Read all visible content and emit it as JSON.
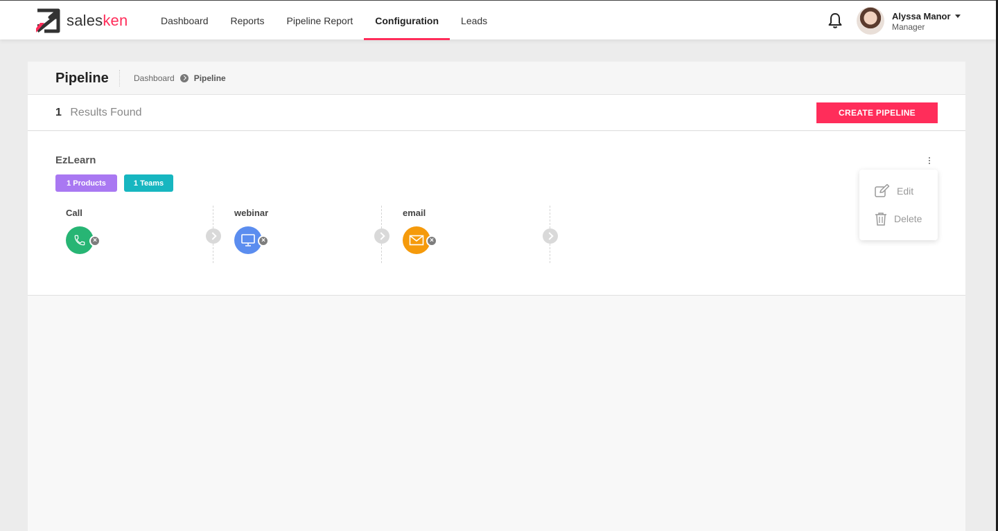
{
  "brand": {
    "name_part1": "sales",
    "name_part2": "ken",
    "accent": "#ff2d5a"
  },
  "nav": {
    "items": [
      {
        "label": "Dashboard"
      },
      {
        "label": "Reports"
      },
      {
        "label": "Pipeline Report"
      },
      {
        "label": "Configuration",
        "active": true
      },
      {
        "label": "Leads"
      }
    ]
  },
  "user": {
    "name": "Alyssa Manor",
    "role": "Manager"
  },
  "page": {
    "title": "Pipeline",
    "breadcrumb": [
      "Dashboard",
      "Pipeline"
    ]
  },
  "results": {
    "count": "1",
    "label": "Results Found",
    "create_button": "CREATE PIPELINE"
  },
  "pipeline": {
    "name": "EzLearn",
    "products_badge": "1 Products",
    "teams_badge": "1 Teams",
    "stages": [
      {
        "label": "Call",
        "icon": "phone-icon",
        "color": "#27b574"
      },
      {
        "label": "webinar",
        "icon": "monitor-icon",
        "color": "#5b8def"
      },
      {
        "label": "email",
        "icon": "envelope-icon",
        "color": "#f59a0b"
      }
    ]
  },
  "menu": {
    "edit": "Edit",
    "delete": "Delete"
  }
}
